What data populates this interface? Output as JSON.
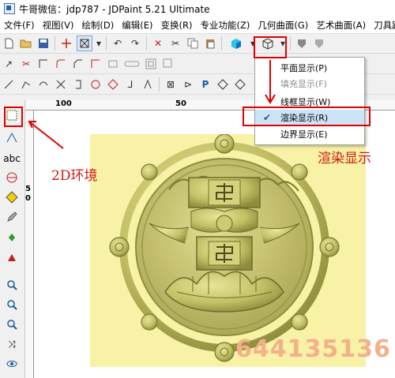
{
  "window": {
    "title": "牛哥微信：jdp787   - JDPaint 5.21 Ultimate"
  },
  "menu": {
    "items": [
      "文件(F)",
      "视图(V)",
      "绘制(D)",
      "编辑(E)",
      "变换(R)",
      "专业功能(Z)",
      "几何曲面(G)",
      "艺术曲面(A)",
      "刀具路径"
    ]
  },
  "ruler": {
    "label_100": "100",
    "label_50": "50",
    "label_5": "5",
    "label_0": "0"
  },
  "display_menu": {
    "items": [
      {
        "label": "平面显示(P)",
        "enabled": true,
        "checked": false
      },
      {
        "label": "填充显示(F)",
        "enabled": false,
        "checked": false
      },
      {
        "label": "线框显示(W)",
        "enabled": true,
        "checked": false
      },
      {
        "label": "渲染显示(R)",
        "enabled": true,
        "checked": true
      },
      {
        "label": "边界显示(E)",
        "enabled": true,
        "checked": false
      }
    ]
  },
  "annotations": {
    "env_2d": "2D环境",
    "render_display": "渲染显示"
  },
  "watermark": "644135136",
  "colors": {
    "annotation_red": "#e00000",
    "relief_gold": "#c8c46a",
    "canvas_bg": "#f7f2a5",
    "selected_item": "#cce4f7"
  }
}
